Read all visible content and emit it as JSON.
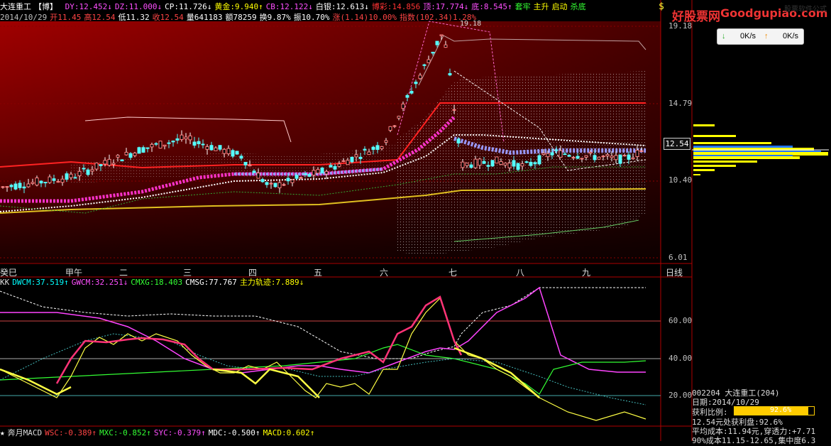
{
  "header": {
    "stock_name": "大连重工",
    "tag": "【博】",
    "items": [
      {
        "text": "DY:12.452↓",
        "color": "#ff4fff"
      },
      {
        "text": "DZ:11.000↓",
        "color": "#ff4fff"
      },
      {
        "text": "CP:11.726↓",
        "color": "#ffffff"
      },
      {
        "text": "黄金:9.940↑",
        "color": "#ffff00"
      },
      {
        "text": "CB:12.122↓",
        "color": "#ff4fff"
      },
      {
        "text": "白银:12.613↓",
        "color": "#ffffff"
      },
      {
        "text": "博彩:14.856",
        "color": "#ff3333"
      },
      {
        "text": "顶:17.774↓",
        "color": "#ff4fff"
      },
      {
        "text": "底:8.545↑",
        "color": "#ff4fff"
      },
      {
        "text": "套牢",
        "color": "#33ff33"
      },
      {
        "text": "主升",
        "color": "#ffff00"
      },
      {
        "text": "启动",
        "color": "#ffff00"
      },
      {
        "text": "杀底",
        "color": "#33ff33"
      }
    ],
    "row2": [
      {
        "text": "2014/10/29",
        "color": "#c0c0c0"
      },
      {
        "text": "开11.45",
        "color": "#ff4444"
      },
      {
        "text": "高12.54",
        "color": "#ff4444"
      },
      {
        "text": "低11.32",
        "color": "#ffffff"
      },
      {
        "text": "收12.54",
        "color": "#ff4444"
      },
      {
        "text": "量641183",
        "color": "#ffffff"
      },
      {
        "text": "额78259",
        "color": "#ffffff"
      },
      {
        "text": "换9.87%",
        "color": "#ffffff"
      },
      {
        "text": "振10.70%",
        "color": "#ffffff"
      },
      {
        "text": "涨(1.14)10.00%",
        "color": "#ff4444"
      },
      {
        "text": "指数(102.34)1.28%",
        "color": "#ff4444"
      }
    ],
    "dollar": "$"
  },
  "price_axis": {
    "ticks": [
      "19.18",
      "14.79",
      "10.40",
      "6.01"
    ],
    "current": "12.54",
    "peak_label": "19.18"
  },
  "date_axis": {
    "labels": [
      "癸巳",
      "甲午",
      "二",
      "三",
      "四",
      "五",
      "六",
      "七",
      "八",
      "九"
    ],
    "period": "日线"
  },
  "indicator1": {
    "name": "KK",
    "items": [
      {
        "text": "DWCM:37.519↑",
        "color": "#00ffff"
      },
      {
        "text": "GWCM:32.251↓",
        "color": "#ff4fff"
      },
      {
        "text": "CMXG:18.403",
        "color": "#33ff33"
      },
      {
        "text": "CMSG:77.767",
        "color": "#ffffff"
      },
      {
        "text": "主力轨迹:7.889↓",
        "color": "#ffff00"
      }
    ],
    "ticks": [
      "60.00",
      "40.00",
      "20.00"
    ]
  },
  "indicator2": {
    "name": "奔月MACD",
    "items": [
      {
        "text": "WSC:-0.389↑",
        "color": "#ff4444"
      },
      {
        "text": "MXC:-0.852↑",
        "color": "#33ff33"
      },
      {
        "text": "SYC:-0.379↑",
        "color": "#ff4fff"
      },
      {
        "text": "MDC:-0.500↑",
        "color": "#ffffff"
      },
      {
        "text": "MACD:0.602↑",
        "color": "#ffff00"
      }
    ]
  },
  "brand": {
    "logo": "好股票网",
    "domain": "Goodgupiao.com",
    "tag": "股票软件公式"
  },
  "net": {
    "down": "0K/s",
    "up": "0K/s"
  },
  "stats": {
    "code": "002204",
    "name": "大连重工",
    "count": "(204)",
    "date": "日期:2014/10/29",
    "profit_label": "获利比例:",
    "profit_value": "92.6%",
    "profit_fill": 0.926,
    "line1": "12.54元处获利盘:92.6%",
    "line2": "平均成本:11.94元,穿透力:+7.71",
    "line3": "90%成本11.15-12.65,集中度6.3"
  },
  "colors": {
    "bg_top": "#7a0505",
    "grid": "#8a0000",
    "ma_white": "#ffffff",
    "ma_pink": "#ff33cc",
    "ma_blue": "#9999ff",
    "ma_red": "#ff2222",
    "ma_yellow": "#e0c020"
  }
}
